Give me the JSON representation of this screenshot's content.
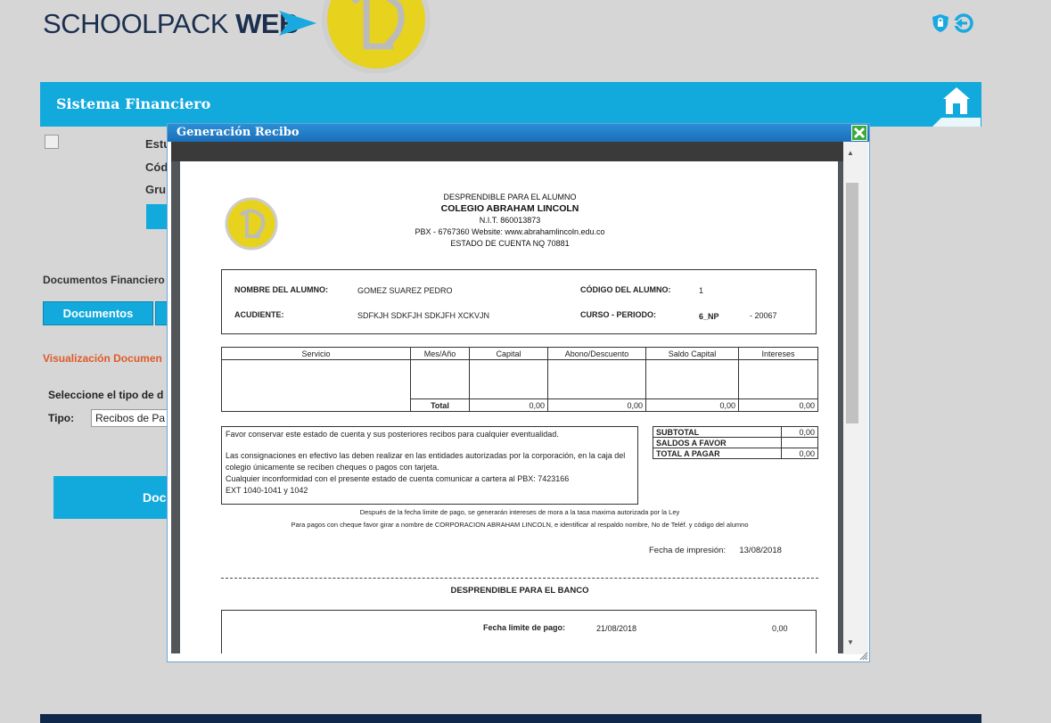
{
  "header": {
    "brand_light": "SCHOOLPACK ",
    "brand_bold": "WEB",
    "icons": [
      "shield-lock-icon",
      "logout-icon"
    ]
  },
  "finbar": {
    "title": "Sistema Financiero",
    "home_icon": "home-icon"
  },
  "background": {
    "student_labels": [
      "Estu",
      "Cód",
      "Gru"
    ],
    "docs_financieros": "Documentos Financiero",
    "tab_documentos": "Documentos",
    "visualizacion": "Visualización Documen",
    "seleccione": "Seleccione el tipo de d",
    "tipo_label": "Tipo:",
    "tipo_value": "Recibos de Pa",
    "doc_button": "Doc"
  },
  "dialog": {
    "title": "Generación Recibo",
    "close_icon": "close-icon"
  },
  "receipt": {
    "header": {
      "line1": "DESPRENDIBLE PARA EL ALUMNO",
      "line2": "COLEGIO ABRAHAM LINCOLN",
      "line3": "N.I.T. 860013873",
      "line4": "PBX - 6767360 Website: www.abrahamlincoln.edu.co",
      "line5": "ESTADO DE CUENTA NQ 70881"
    },
    "student": {
      "name_label": "NOMBRE DEL ALUMNO:",
      "name_value": "GOMEZ SUAREZ PEDRO",
      "code_label": "CÓDIGO DEL ALUMNO:",
      "code_value": "1",
      "guardian_label": "ACUDIENTE:",
      "guardian_value": "SDFKJH SDKFJH SDKJFH XCKVJN",
      "course_label": "CURSO - PERIODO:",
      "course_value": "6_NP",
      "period_value": "- 20067"
    },
    "table": {
      "headers": [
        "Servicio",
        "Mes/Año",
        "Capital",
        "Abono/Descuento",
        "Saldo Capital",
        "Intereses"
      ],
      "total_label": "Total",
      "totals": [
        "0,00",
        "0,00",
        "0,00",
        "0,00"
      ]
    },
    "notes": {
      "n1": "Favor conservar este estado de cuenta y sus posteriores recibos para cualquier eventualidad.",
      "n2": "Las consignaciones en efectivo las deben realizar en las entidades autorizadas por la corporación, en la caja del colegio únicamente se reciben cheques o pagos con tarjeta.",
      "n3": "Cualquier inconformidad con el presente estado de cuenta comunicar a cartera al PBX:  7423166",
      "n4": "EXT 1040-1041 y 1042"
    },
    "totals_box": {
      "subtotal_label": "SUBTOTAL",
      "subtotal_value": "0,00",
      "saldos_label": "SALDOS A FAVOR",
      "saldos_value": "",
      "total_label": "TOTAL A PAGAR",
      "total_value": "0,00"
    },
    "small1": "Después de la fecha limite de pago, se generarán intereses de mora a la tasa maxima autorizada por la Ley",
    "small2": "Para pagos con cheque favor girar a nombre de CORPORACION ABRAHAM LINCOLN, e identificar al respaldo nombre, No de Teléf. y código del alumno",
    "fecha_impresion_label": "Fecha de impresión:",
    "fecha_impresion_value": "13/08/2018",
    "banco_title": "DESPRENDIBLE PARA EL BANCO",
    "fecha_limite_label": "Fecha limite de pago:",
    "fecha_limite_value": "21/08/2018",
    "banco_amount": "0,00"
  },
  "colors": {
    "accent": "#12a9dc",
    "title_bar": "#1a6fb8",
    "brand": "#1c2f4f",
    "orange": "#e05a28"
  }
}
